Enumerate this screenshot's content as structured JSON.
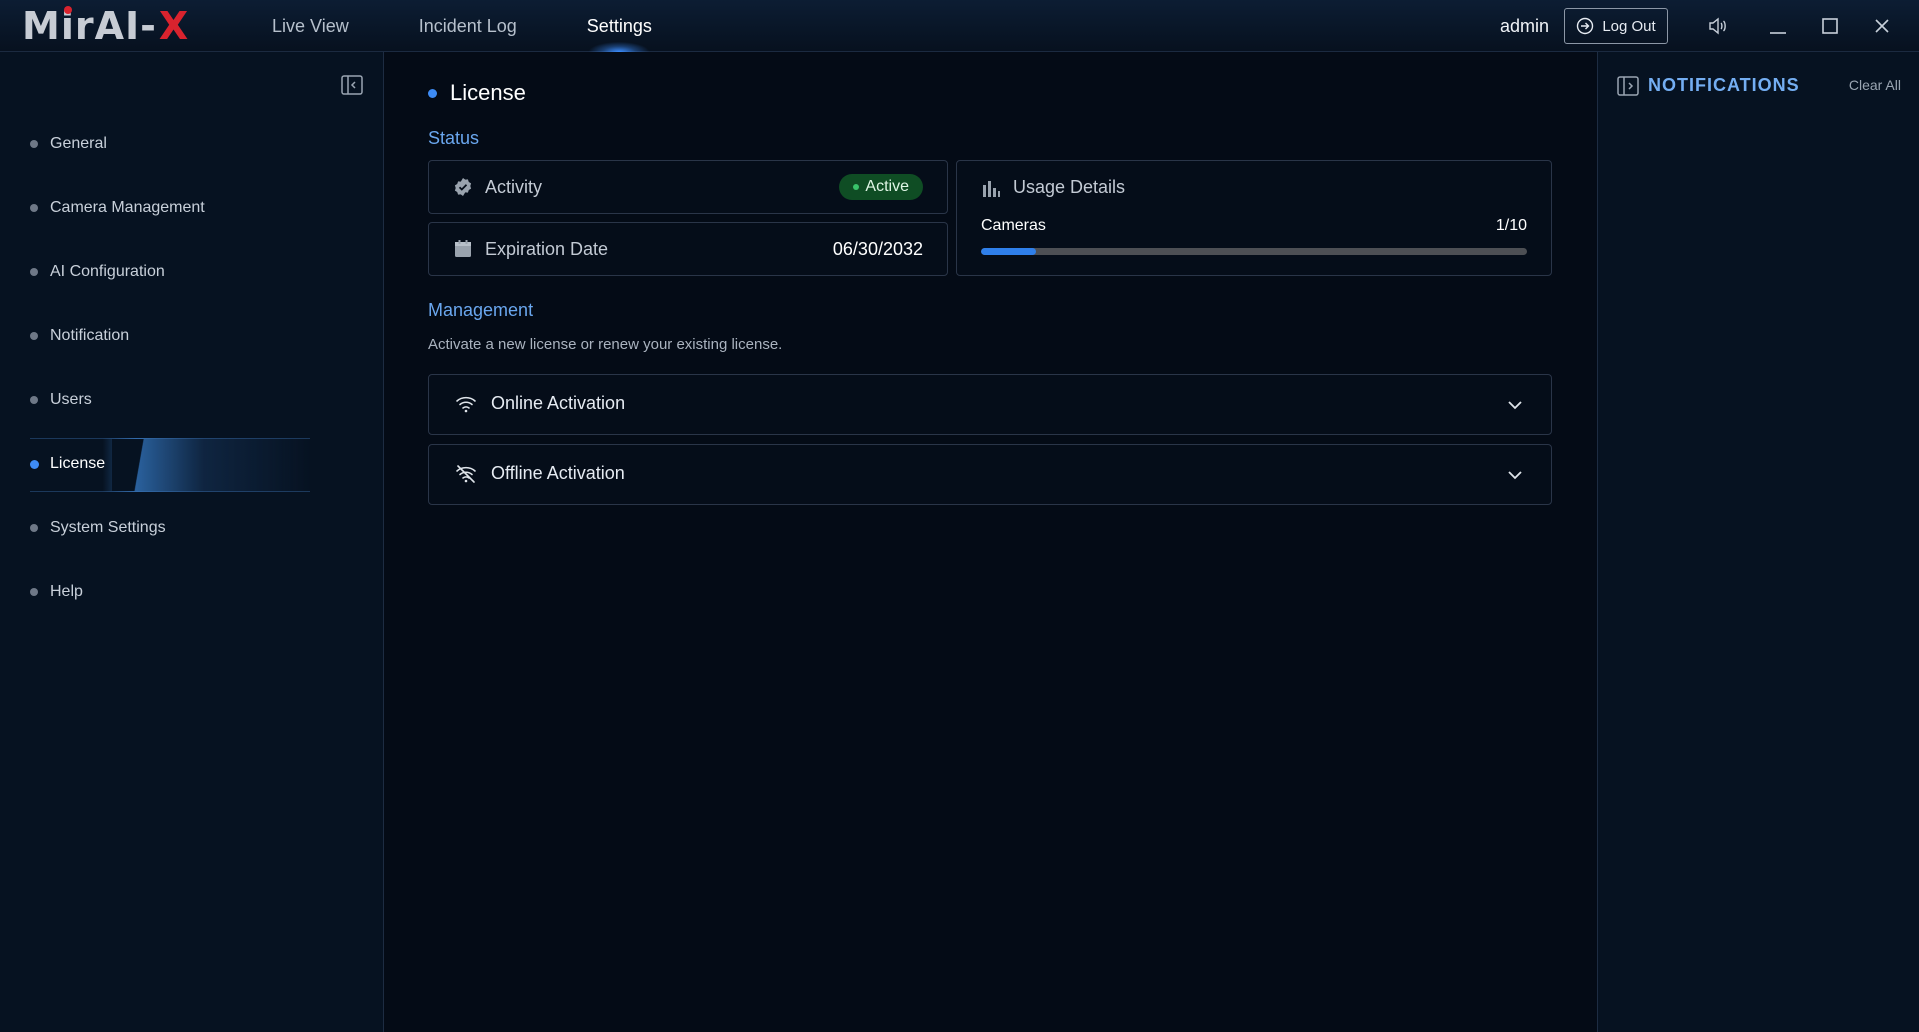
{
  "app": {
    "logo_main": "MirAI-",
    "logo_x": "X"
  },
  "nav": {
    "tabs": [
      {
        "label": "Live View"
      },
      {
        "label": "Incident Log"
      },
      {
        "label": "Settings"
      }
    ]
  },
  "header": {
    "user": "admin",
    "logout_label": "Log Out"
  },
  "sidebar": {
    "items": [
      {
        "label": "General"
      },
      {
        "label": "Camera Management"
      },
      {
        "label": "AI Configuration"
      },
      {
        "label": "Notification"
      },
      {
        "label": "Users"
      },
      {
        "label": "License"
      },
      {
        "label": "System Settings"
      },
      {
        "label": "Help"
      }
    ],
    "active_index": 5
  },
  "main": {
    "title": "License",
    "status": {
      "heading": "Status",
      "activity_label": "Activity",
      "activity_value": "Active",
      "expiration_label": "Expiration Date",
      "expiration_value": "06/30/2032",
      "usage_title": "Usage Details",
      "cameras_label": "Cameras",
      "cameras_value": "1/10",
      "cameras_used": 1,
      "cameras_total": 10
    },
    "management": {
      "heading": "Management",
      "description": "Activate a new license or renew your existing license.",
      "online_label": "Online Activation",
      "offline_label": "Offline Activation"
    }
  },
  "notifications": {
    "title": "NOTIFICATIONS",
    "clear_label": "Clear All"
  },
  "colors": {
    "accent": "#6aa7ef",
    "active_badge": "#0f4d24",
    "progress": "#2f7fea",
    "logo_red": "#d9232e"
  }
}
